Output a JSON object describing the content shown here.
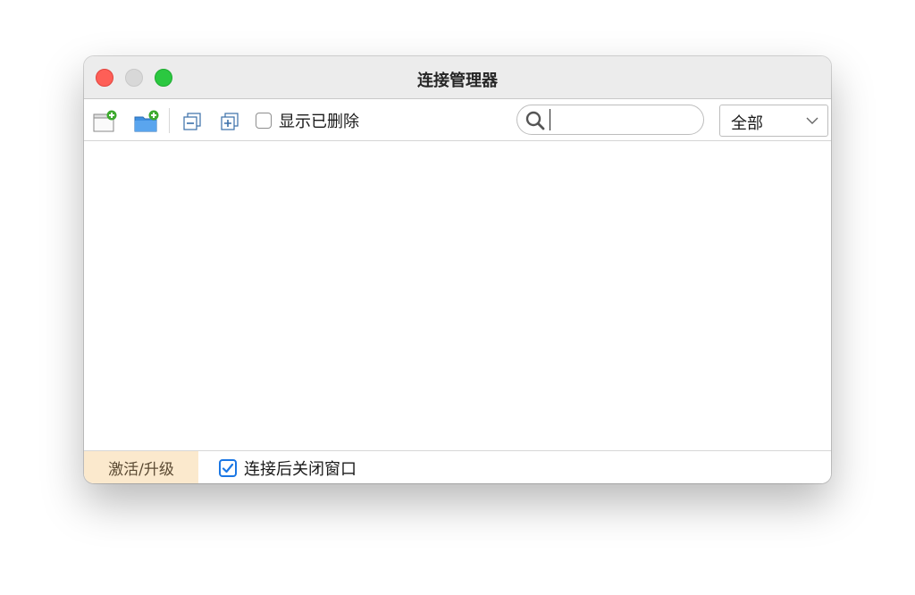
{
  "window": {
    "title": "连接管理器"
  },
  "toolbar": {
    "new_connection_icon": "new-window-plus-icon",
    "new_folder_icon": "folder-plus-icon",
    "collapse_icon": "collapse-all-icon",
    "expand_icon": "expand-all-icon",
    "show_deleted_label": "显示已删除",
    "show_deleted_checked": false,
    "search": {
      "value": "",
      "placeholder": ""
    },
    "filter": {
      "selected": "全部"
    }
  },
  "footer": {
    "activate_label": "激活/升级",
    "close_after_connect_label": "连接后关闭窗口",
    "close_after_connect_checked": true
  },
  "colors": {
    "close": "#fe5f57",
    "minimize": "#d8d8d8",
    "maximize": "#2bc840",
    "accent": "#1b77e4",
    "activate_bg": "#fbe9cd"
  }
}
